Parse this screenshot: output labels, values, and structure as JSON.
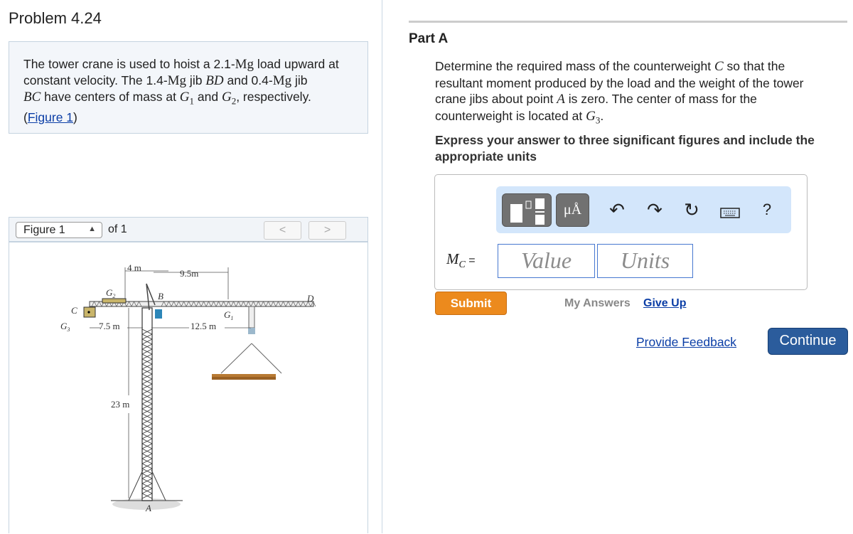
{
  "title": "Problem 4.24",
  "problem": {
    "t1": "The tower crane is used to hoist a 2.1-",
    "mg1": "Mg",
    "t2": " load upward at constant velocity. The 1.4-",
    "mg2": "Mg",
    "t3": " jib ",
    "bd": "BD",
    "t4": " and 0.4-",
    "mg3": "Mg",
    "t5": " jib ",
    "bc": "BC",
    "t6": " have centers of mass at ",
    "g1": "G",
    "g1sub": "1",
    "t7": " and ",
    "g2": "G",
    "g2sub": "2",
    "t8": ", respectively.",
    "fig_open": "(",
    "fig_link": "Figure 1",
    "fig_close": ")"
  },
  "figure": {
    "select": "Figure 1",
    "of": "of 1",
    "prev": "<",
    "next": ">",
    "labels": {
      "d4": "4 m",
      "d95": "9.5m",
      "g2": "G",
      "g2s": "2",
      "b": "B",
      "d": "D",
      "c": "C",
      "g1": "G",
      "g1s": "1",
      "g3": "G",
      "g3s": "3",
      "d75": "7.5 m",
      "d125": "12.5 m",
      "d23": "23 m",
      "a": "A"
    }
  },
  "part": {
    "title": "Part A",
    "q1": "Determine the required mass of the counterweight ",
    "c": "C",
    "q2": " so that the resultant moment produced by the load and the weight of the tower crane jibs about point ",
    "a": "A",
    "q3": " is zero. The center of mass for the counterweight is located at ",
    "g3": "G",
    "g3sub": "3",
    "q4": ".",
    "instructions": "Express your answer to three significant figures and include the appropriate units"
  },
  "toolbar": {
    "units_label": "μÅ",
    "undo": "undo-icon",
    "redo": "redo-icon",
    "reset": "reset-icon",
    "keyboard": "keyboard-icon",
    "help": "?"
  },
  "answer": {
    "var": "M",
    "var_sub": "C",
    "eq": " =",
    "value_placeholder": "Value",
    "units_placeholder": "Units"
  },
  "actions": {
    "submit": "Submit",
    "my_answers": "My Answers",
    "give_up": "Give Up",
    "feedback": "Provide Feedback",
    "continue": "Continue"
  },
  "colors": {
    "submit": "#ec8a1d",
    "continue": "#2b5c9c",
    "toolbar": "#d3e6fb",
    "link": "#0b3ea6"
  }
}
